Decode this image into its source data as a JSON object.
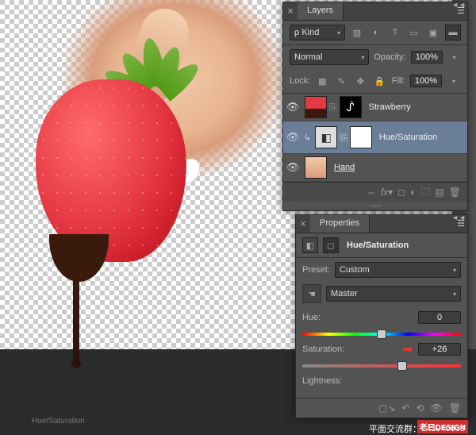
{
  "layers_panel": {
    "title": "Layers",
    "filter_label": "Kind",
    "blend_mode": "Normal",
    "opacity_label": "Opacity:",
    "opacity_value": "100%",
    "lock_label": "Lock:",
    "fill_label": "Fill:",
    "fill_value": "100%",
    "layers": [
      {
        "name": "Strawberry"
      },
      {
        "name": "Hue/Saturation"
      },
      {
        "name": "Hand"
      }
    ]
  },
  "properties_panel": {
    "title": "Properties",
    "adj_title": "Hue/Saturation",
    "preset_label": "Preset:",
    "preset_value": "Custom",
    "channel_value": "Master",
    "hue_label": "Hue:",
    "hue_value": "0",
    "sat_label": "Saturation:",
    "sat_value": "+26",
    "light_label": "Lightness:"
  },
  "footer": {
    "brand": "老三DESIGN",
    "group_label": "平面交流群：",
    "group_id": "43940608"
  },
  "status": "Hue/Saturation"
}
